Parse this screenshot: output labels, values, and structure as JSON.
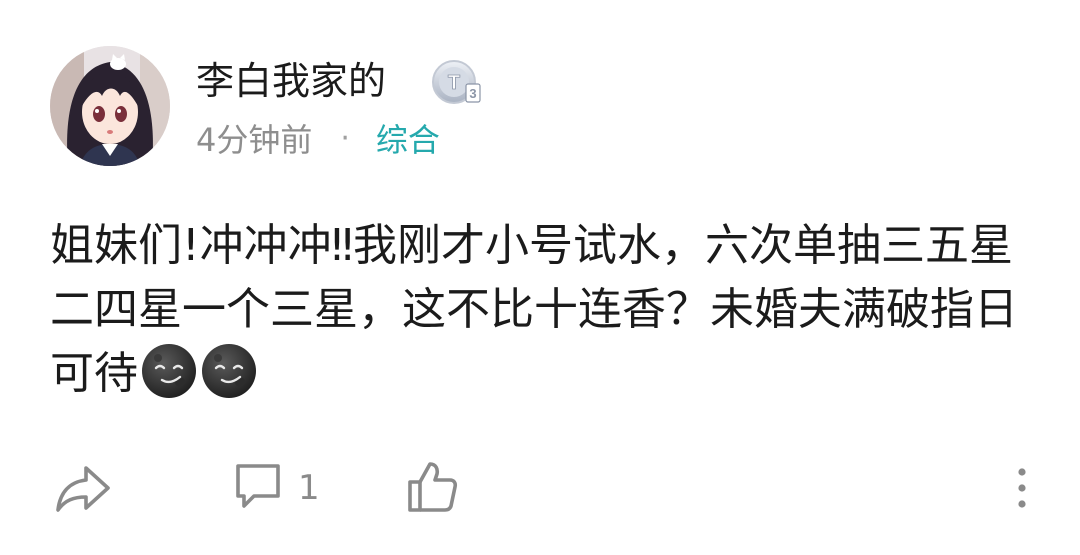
{
  "user": {
    "name": "李白我家的",
    "badge": "T3",
    "avatar": "avatar"
  },
  "meta": {
    "time": "4分钟前",
    "separator": "·",
    "category": "综合"
  },
  "post": {
    "text": "姐妹们!冲冲冲‼我刚才小号试水，六次单抽三五星二四星一个三星，这不比十连香？未婚夫满破指日可待",
    "emojis": [
      "smirking-moon-emoji",
      "smirking-moon-emoji"
    ]
  },
  "actions": {
    "share_icon": "share-icon",
    "comment_icon": "comment-icon",
    "comment_count": "1",
    "like_icon": "thumbs-up-icon",
    "more_icon": "more-vertical-icon"
  },
  "colors": {
    "category": "#25a9ad",
    "meta_text": "#8e8e8e",
    "icon": "#8a8a8a"
  }
}
